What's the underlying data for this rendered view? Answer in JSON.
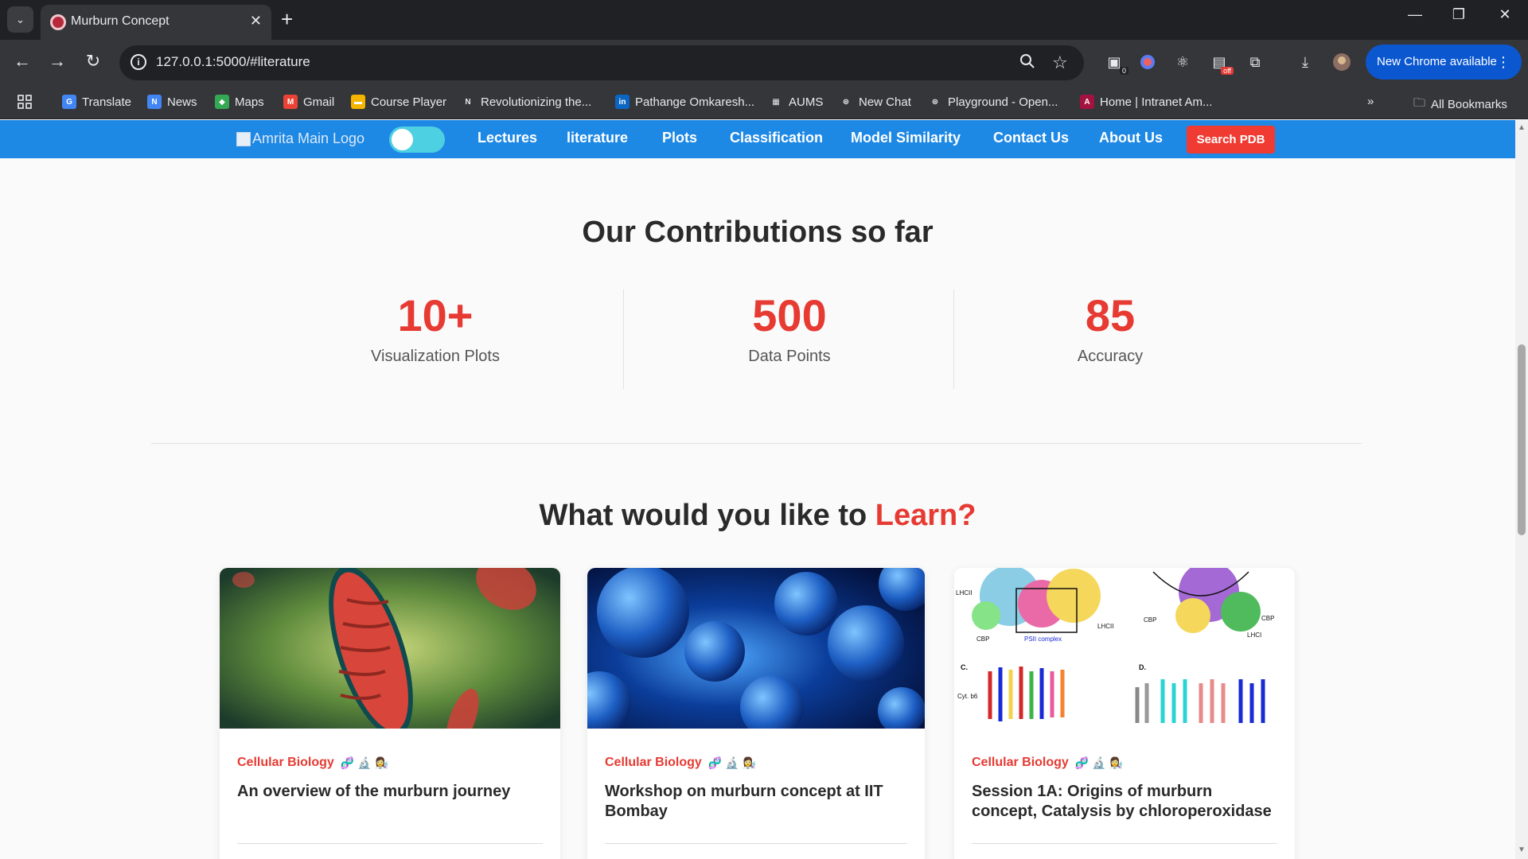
{
  "browser": {
    "tab_title": "Murburn Concept",
    "url": "127.0.0.1:5000/#literature",
    "update_label": "New Chrome available",
    "ext_badge_count": "0",
    "ext_badge_off": "off"
  },
  "bookmarks": [
    {
      "label": "Translate",
      "icon": "translate-icon",
      "color": "#4285f4"
    },
    {
      "label": "News",
      "icon": "news-icon",
      "color": "#4285f4"
    },
    {
      "label": "Maps",
      "icon": "maps-icon",
      "color": "#34a853"
    },
    {
      "label": "Gmail",
      "icon": "gmail-icon",
      "color": "#ea4335"
    },
    {
      "label": "Course Player",
      "icon": "course-player-icon",
      "color": "#f4b400"
    },
    {
      "label": "Revolutionizing the...",
      "icon": "nct-icon",
      "color": "#ffffff"
    },
    {
      "label": "Pathange Omkaresh...",
      "icon": "linkedin-icon",
      "color": "#0a66c2"
    },
    {
      "label": "AUMS",
      "icon": "aums-icon",
      "color": "#ffffff"
    },
    {
      "label": "New Chat",
      "icon": "openai-icon",
      "color": "#e8eaed"
    },
    {
      "label": "Playground - Open...",
      "icon": "openai-icon",
      "color": "#e8eaed"
    },
    {
      "label": "Home | Intranet Am...",
      "icon": "amrita-icon",
      "color": "#a4123f"
    }
  ],
  "all_bookmarks_label": "All Bookmarks",
  "site_nav": {
    "logo_alt": "Amrita Main Logo",
    "links": [
      "Lectures",
      "literature",
      "Plots",
      "Classification",
      "Model Similarity",
      "Contact Us",
      "About Us"
    ],
    "search_label": "Search PDB"
  },
  "contributions": {
    "heading": "Our Contributions so far",
    "stats": [
      {
        "value": "10+",
        "label": "Visualization Plots"
      },
      {
        "value": "500",
        "label": "Data Points"
      },
      {
        "value": "85",
        "label": "Accuracy"
      }
    ]
  },
  "learn": {
    "heading_prefix": "What would you like to",
    "heading_accent": "Learn?",
    "cards": [
      {
        "category": "Cellular Biology",
        "emojis": "🧬 🔬 👩‍🔬",
        "title": "An overview of the murburn journey"
      },
      {
        "category": "Cellular Biology",
        "emojis": "🧬 🔬 👩‍🔬",
        "title": "Workshop on murburn concept at IIT Bombay"
      },
      {
        "category": "Cellular Biology",
        "emojis": "🧬 🔬 👩‍🔬",
        "title": "Session 1A: Origins of murburn concept, Catalysis by chloroperoxidase"
      }
    ],
    "diagram_labels": [
      "LHCII",
      "CBP",
      "PSII complex",
      "LHCII",
      "CBP",
      "LHCI",
      "CBP",
      "C.",
      "D.",
      "Cyt. b6"
    ]
  },
  "colors": {
    "nav_blue": "#1e88e5",
    "accent_red": "#e63a32",
    "toggle_cyan": "#4dd0e1"
  }
}
